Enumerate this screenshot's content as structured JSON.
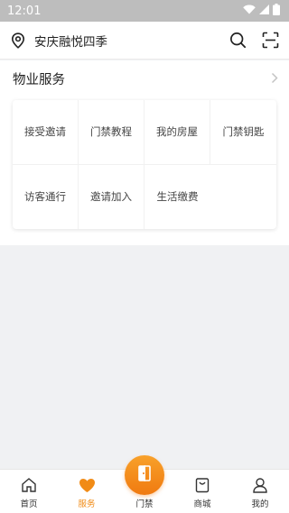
{
  "status_bar": {
    "time": "12:01"
  },
  "header": {
    "community_name": "安庆融悦四季"
  },
  "property_services": {
    "title": "物业服务",
    "items": [
      {
        "label": "接受邀请"
      },
      {
        "label": "门禁教程"
      },
      {
        "label": "我的房屋"
      },
      {
        "label": "门禁钥匙"
      },
      {
        "label": "访客通行"
      },
      {
        "label": "邀请加入"
      },
      {
        "label": "生活缴费"
      }
    ]
  },
  "tab_bar": {
    "tabs": [
      {
        "label": "首页",
        "icon": "home-icon"
      },
      {
        "label": "服务",
        "icon": "heart-icon"
      },
      {
        "label": "门禁",
        "icon": "door-icon"
      },
      {
        "label": "商城",
        "icon": "shopping-bag-icon"
      },
      {
        "label": "我的",
        "icon": "user-icon"
      }
    ],
    "active_index": 1
  },
  "colors": {
    "accent": "#f18b16",
    "statusbar_bg": "#bdbdbd",
    "page_bg": "#f0f1f3"
  }
}
